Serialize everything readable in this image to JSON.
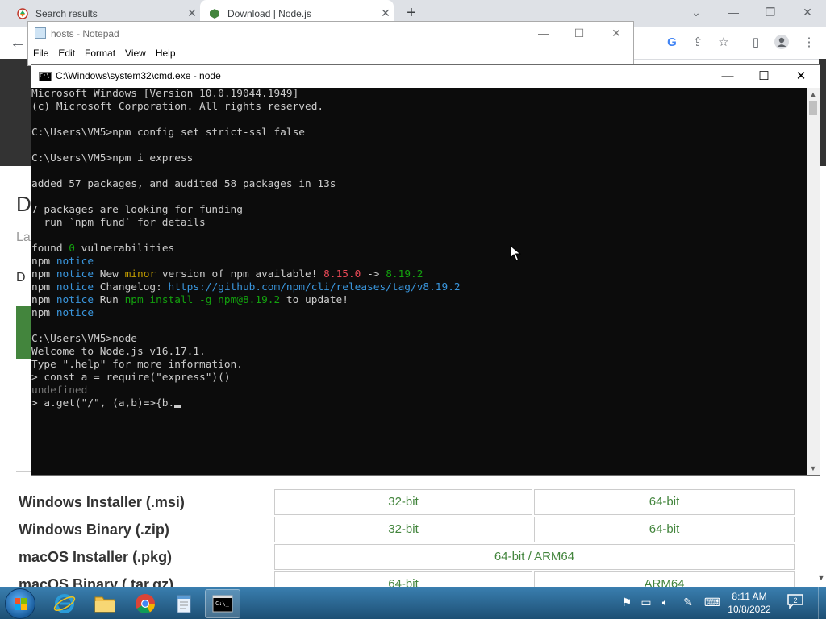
{
  "browser": {
    "tabs": [
      {
        "title": "Search results",
        "icon": "search-results-favicon"
      },
      {
        "title": "Download | Node.js",
        "icon": "nodejs-favicon"
      }
    ],
    "new_tab_label": "+",
    "page": {
      "heading_fragment": "D",
      "subtext_fragment": "La",
      "label_fragment": "D",
      "downloads": [
        {
          "label": "Windows Installer (.msi)",
          "options": [
            "32-bit",
            "64-bit"
          ]
        },
        {
          "label": "Windows Binary (.zip)",
          "options": [
            "32-bit",
            "64-bit"
          ]
        },
        {
          "label": "macOS Installer (.pkg)",
          "options": [
            "64-bit / ARM64"
          ]
        },
        {
          "label": "macOS Binary (.tar.gz)",
          "options": [
            "64-bit",
            "ARM64"
          ]
        }
      ]
    }
  },
  "notepad": {
    "title": "hosts - Notepad",
    "menu": [
      "File",
      "Edit",
      "Format",
      "View",
      "Help"
    ]
  },
  "cmd": {
    "title": "C:\\Windows\\system32\\cmd.exe - node",
    "lines": [
      [
        {
          "t": "Microsoft Windows [Version 10.0.19044.1949]"
        }
      ],
      [
        {
          "t": "(c) Microsoft Corporation. All rights reserved."
        }
      ],
      [],
      [
        {
          "t": "C:\\Users\\VM5>npm config set strict-ssl false"
        }
      ],
      [],
      [
        {
          "t": "C:\\Users\\VM5>npm i express"
        }
      ],
      [],
      [
        {
          "t": "added 57 packages, and audited 58 packages in 13s"
        }
      ],
      [],
      [
        {
          "t": "7 packages are looking for funding"
        }
      ],
      [
        {
          "t": "  run `npm fund` for details"
        }
      ],
      [],
      [
        {
          "t": "found "
        },
        {
          "t": "0",
          "c": "green"
        },
        {
          "t": " vulnerabilities"
        }
      ],
      [
        {
          "t": "npm "
        },
        {
          "t": "notice",
          "c": "cyan"
        }
      ],
      [
        {
          "t": "npm "
        },
        {
          "t": "notice",
          "c": "cyan"
        },
        {
          "t": " New "
        },
        {
          "t": "minor",
          "c": "yellow"
        },
        {
          "t": " version of npm available! "
        },
        {
          "t": "8.15.0",
          "c": "red"
        },
        {
          "t": " -> "
        },
        {
          "t": "8.19.2",
          "c": "green"
        }
      ],
      [
        {
          "t": "npm "
        },
        {
          "t": "notice",
          "c": "cyan"
        },
        {
          "t": " Changelog: "
        },
        {
          "t": "https://github.com/npm/cli/releases/tag/v8.19.2",
          "c": "cyan"
        }
      ],
      [
        {
          "t": "npm "
        },
        {
          "t": "notice",
          "c": "cyan"
        },
        {
          "t": " Run "
        },
        {
          "t": "npm install -g npm@8.19.2",
          "c": "green"
        },
        {
          "t": " to update!"
        }
      ],
      [
        {
          "t": "npm "
        },
        {
          "t": "notice",
          "c": "cyan"
        }
      ],
      [],
      [
        {
          "t": "C:\\Users\\VM5>node"
        }
      ],
      [
        {
          "t": "Welcome to Node.js v16.17.1."
        }
      ],
      [
        {
          "t": "Type \".help\" for more information."
        }
      ],
      [
        {
          "t": "> const a = require(\"express\")()"
        }
      ],
      [
        {
          "t": "undefined",
          "c": "gray"
        }
      ],
      [
        {
          "t": "> a.get(\"/\", (a,b)=>{b."
        },
        {
          "cursor": true
        }
      ]
    ]
  },
  "taskbar": {
    "apps": [
      "internet-explorer",
      "file-explorer",
      "chrome",
      "notepad",
      "cmd"
    ],
    "clock_time": "8:11 AM",
    "clock_date": "10/8/2022",
    "notification_count": "2"
  },
  "colors": {
    "cmd_bg": "#0c0c0c",
    "cmd_fg": "#cccccc",
    "npm_notice": "#3a96dd",
    "npm_version_old": "#e74856",
    "npm_version_new": "#13a10e",
    "node_green": "#43853d",
    "taskbar": "#1d4f74"
  }
}
